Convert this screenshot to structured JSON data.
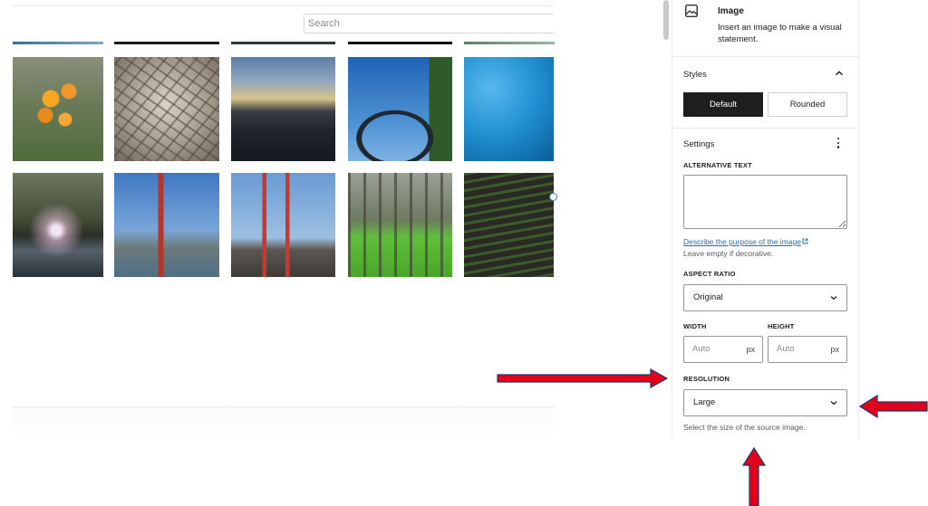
{
  "gallery": {
    "search": {
      "placeholder": "Search"
    },
    "thumbnails": [
      {
        "name": "orange-lily-photo"
      },
      {
        "name": "wooden-wheel-photo"
      },
      {
        "name": "sunset-sky-photo"
      },
      {
        "name": "steel-arch-bridge-photo"
      },
      {
        "name": "blue-water-photo"
      },
      {
        "name": "forest-river-photo"
      },
      {
        "name": "golden-gate-bridge-photo"
      },
      {
        "name": "red-tower-pier-photo"
      },
      {
        "name": "pine-forest-photo"
      },
      {
        "name": "crop-rows-photo"
      }
    ]
  },
  "sidebar": {
    "block": {
      "icon": "image-icon",
      "title": "Image",
      "description": "Insert an image to make a visual statement."
    },
    "styles": {
      "title": "Styles",
      "default_label": "Default",
      "rounded_label": "Rounded"
    },
    "settings": {
      "title": "Settings",
      "alt_text_label": "ALTERNATIVE TEXT",
      "alt_text_value": "",
      "alt_help_link": "Describe the purpose of the image",
      "alt_help_text": "Leave empty if decorative.",
      "aspect_ratio_label": "ASPECT RATIO",
      "aspect_ratio_value": "Original",
      "width_label": "WIDTH",
      "width_placeholder": "Auto",
      "width_unit": "px",
      "height_label": "HEIGHT",
      "height_placeholder": "Auto",
      "height_unit": "px",
      "resolution_label": "RESOLUTION",
      "resolution_value": "Large",
      "resolution_help": "Select the size of the source image."
    }
  },
  "colors": {
    "accent_dark": "#1e1e1e",
    "link": "#2a6db0",
    "annotation_red": "#e3001b",
    "annotation_navy": "#1f3a6b"
  }
}
